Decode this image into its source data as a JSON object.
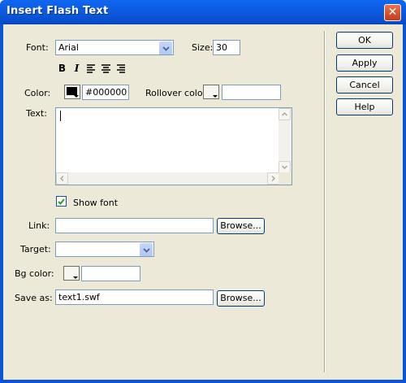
{
  "window": {
    "title": "Insert Flash Text",
    "close_glyph": "✕"
  },
  "font": {
    "label": "Font:",
    "value": "Arial"
  },
  "size": {
    "label": "Size:",
    "value": "30"
  },
  "format": {
    "bold": "B",
    "italic": "I"
  },
  "color": {
    "label": "Color:",
    "value": "#000000",
    "swatch": "#000000"
  },
  "rollover": {
    "label": "Rollover color:",
    "value": ""
  },
  "text": {
    "label": "Text:",
    "value": ""
  },
  "show_font": {
    "label": "Show font",
    "checked": true
  },
  "link": {
    "label": "Link:",
    "value": "",
    "browse_label": "Browse..."
  },
  "target": {
    "label": "Target:",
    "value": ""
  },
  "bgcolor": {
    "label": "Bg color:",
    "value": ""
  },
  "save_as": {
    "label": "Save as:",
    "value": "text1.swf",
    "browse_label": "Browse..."
  },
  "buttons": {
    "ok": "OK",
    "apply": "Apply",
    "cancel": "Cancel",
    "help": "Help"
  }
}
